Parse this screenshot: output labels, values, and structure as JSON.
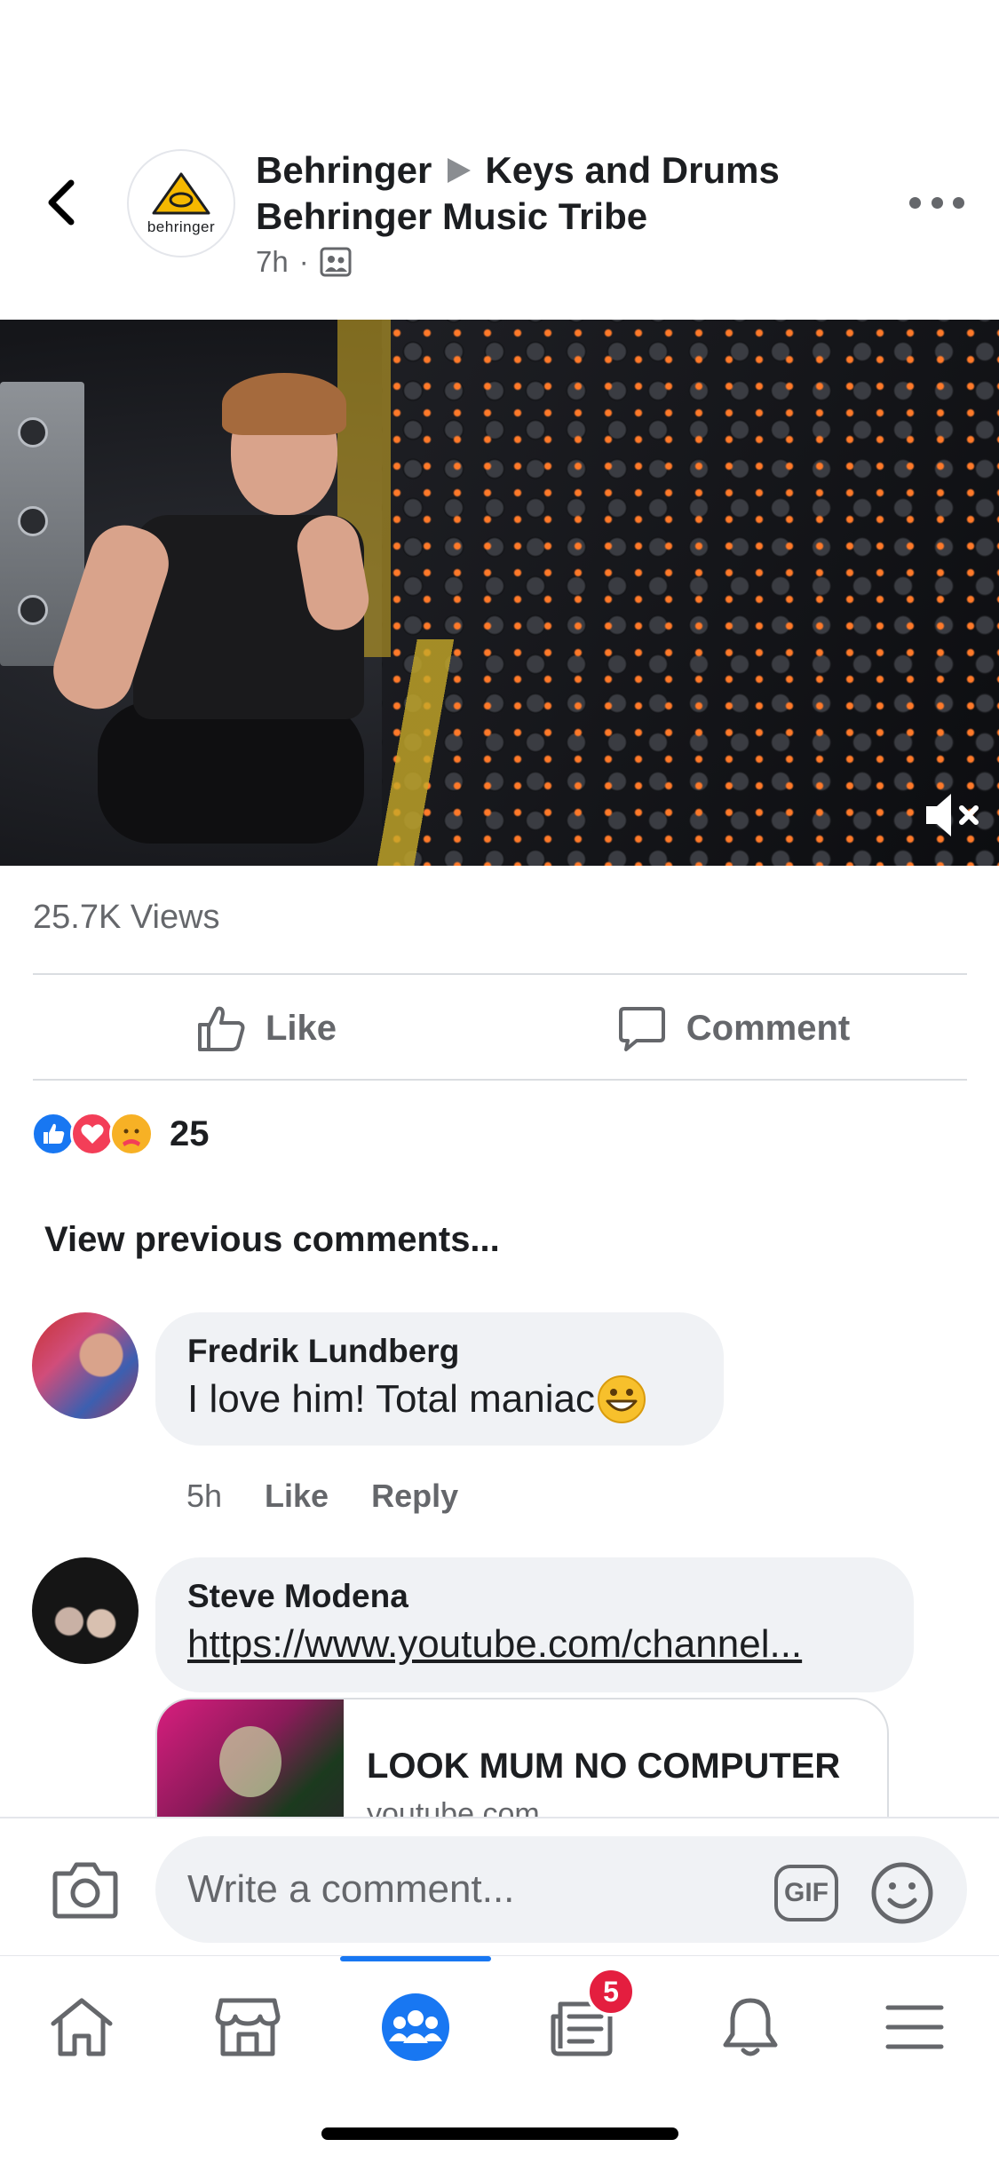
{
  "post": {
    "author": "Behringer",
    "target_line1": "Keys and Drums",
    "target_line2": "Behringer Music Tribe",
    "page_logo_text": "behringer",
    "time": "7h",
    "audience_icon": "group-audience-icon",
    "views": "25.7K Views",
    "like_label": "Like",
    "comment_label": "Comment",
    "reaction_count": "25",
    "reactions": [
      "like",
      "love",
      "care"
    ]
  },
  "comments": {
    "view_previous": "View previous comments...",
    "items": [
      {
        "name": "Fredrik Lundberg",
        "text": "I love him! Total maniac",
        "emoji": "grinning-emoji",
        "time": "5h",
        "like": "Like",
        "reply": "Reply"
      },
      {
        "name": "Steve Modena",
        "link": "https://www.youtube.com/channel...",
        "card_title": "LOOK MUM NO COMPUTER",
        "card_domain": "youtube.com"
      }
    ]
  },
  "composer": {
    "placeholder": "Write a comment...",
    "gif_label": "GIF"
  },
  "tabbar": {
    "items": [
      "home-icon",
      "marketplace-icon",
      "groups-icon",
      "news-icon",
      "notifications-icon",
      "menu-icon"
    ],
    "active": "groups-icon",
    "badge": "5"
  },
  "colors": {
    "accent": "#1877f2",
    "badge": "#e41e3f",
    "secondary_text": "#65676b",
    "bubble": "#f0f2f5"
  }
}
